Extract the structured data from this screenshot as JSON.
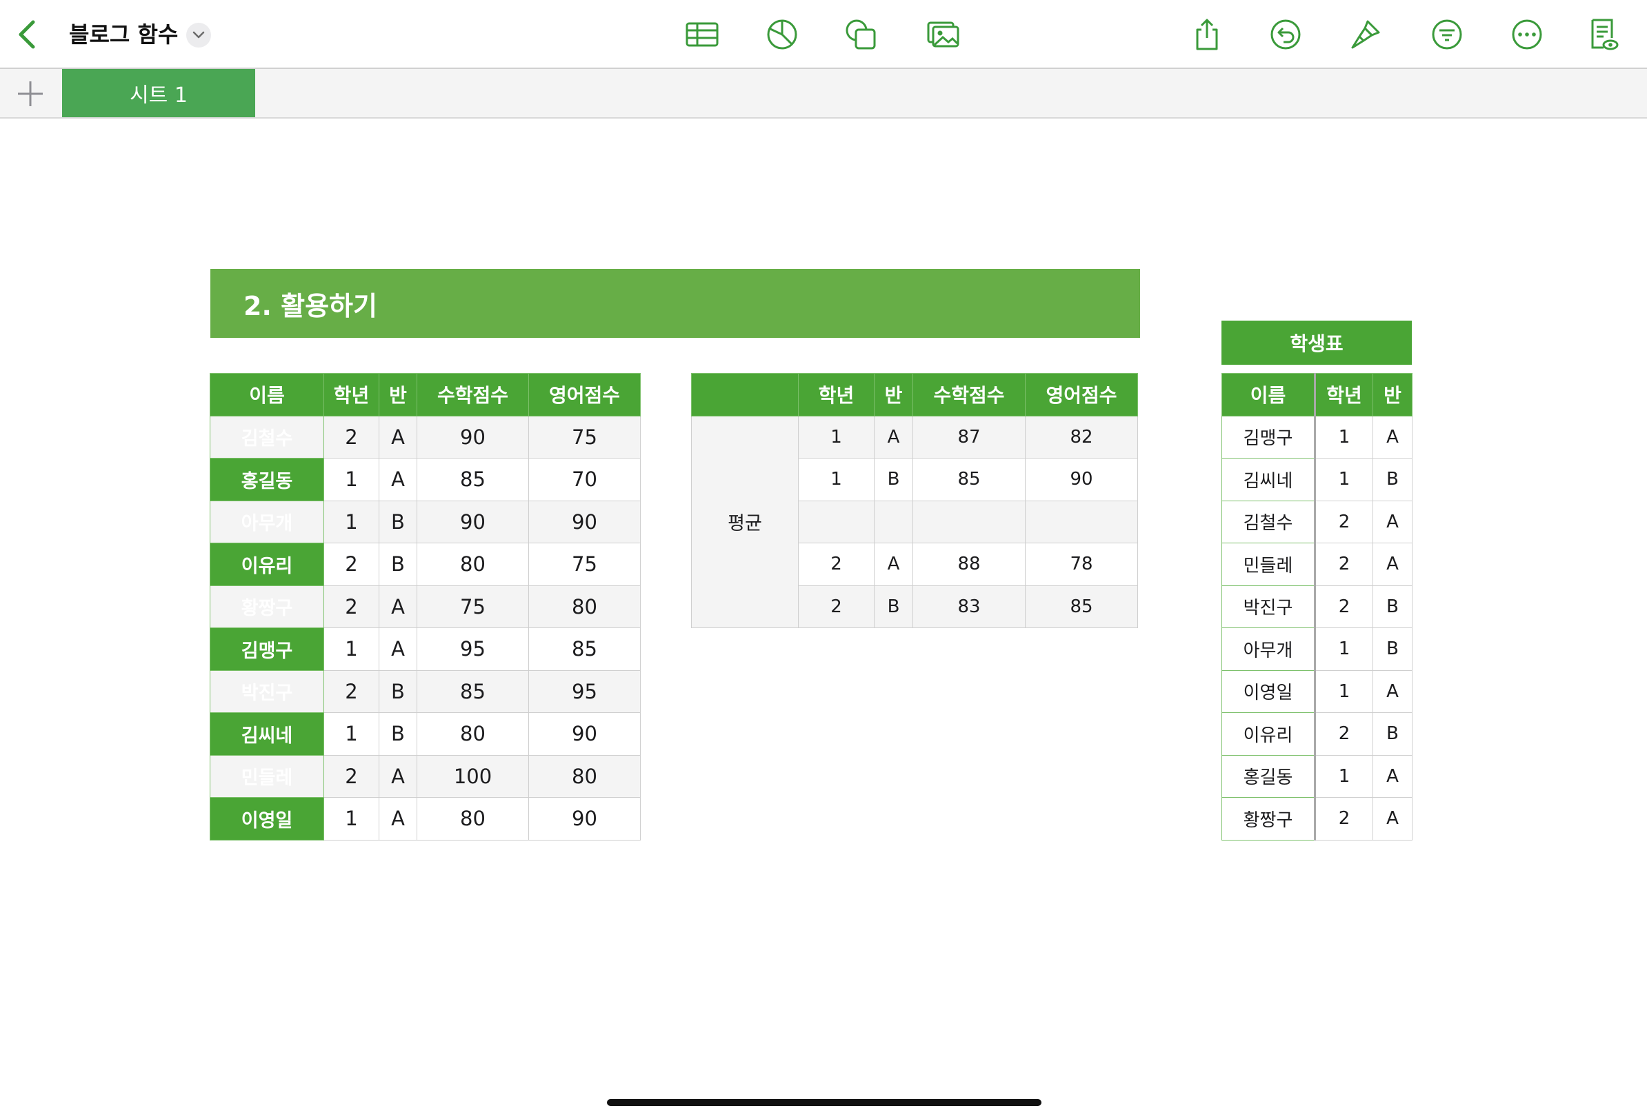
{
  "toolbar": {
    "title": "블로그 함수",
    "accent": "#3a9a3a",
    "icons": [
      "chevron-left-icon",
      "chevron-down-icon",
      "table-icon",
      "chart-icon",
      "shape-icon",
      "media-icon",
      "share-icon",
      "undo-icon",
      "format-brush-icon",
      "filter-icon",
      "more-icon",
      "view-options-icon"
    ]
  },
  "tabs": {
    "sheet_label": "시트 1",
    "active_color": "#4aa654"
  },
  "banner": {
    "title": "2. 활용하기",
    "color": "#67ae47"
  },
  "table1": {
    "headers": [
      "이름",
      "학년",
      "반",
      "수학점수",
      "영어점수"
    ],
    "rows": [
      [
        "김철수",
        "2",
        "A",
        "90",
        "75"
      ],
      [
        "홍길동",
        "1",
        "A",
        "85",
        "70"
      ],
      [
        "아무개",
        "1",
        "B",
        "90",
        "90"
      ],
      [
        "이유리",
        "2",
        "B",
        "80",
        "75"
      ],
      [
        "황짱구",
        "2",
        "A",
        "75",
        "80"
      ],
      [
        "김맹구",
        "1",
        "A",
        "95",
        "85"
      ],
      [
        "박진구",
        "2",
        "B",
        "85",
        "95"
      ],
      [
        "김씨네",
        "1",
        "B",
        "80",
        "90"
      ],
      [
        "민들레",
        "2",
        "A",
        "100",
        "80"
      ],
      [
        "이영일",
        "1",
        "A",
        "80",
        "90"
      ]
    ]
  },
  "table2": {
    "headers": [
      "",
      "학년",
      "반",
      "수학점수",
      "영어점수"
    ],
    "row_label": "평균",
    "rows": [
      [
        "1",
        "A",
        "87",
        "82"
      ],
      [
        "1",
        "B",
        "85",
        "90"
      ],
      [
        "",
        "",
        "",
        ""
      ],
      [
        "2",
        "A",
        "88",
        "78"
      ],
      [
        "2",
        "B",
        "83",
        "85"
      ]
    ]
  },
  "table3": {
    "caption": "학생표",
    "headers": [
      "이름",
      "학년",
      "반"
    ],
    "rows": [
      [
        "김맹구",
        "1",
        "A"
      ],
      [
        "김씨네",
        "1",
        "B"
      ],
      [
        "김철수",
        "2",
        "A"
      ],
      [
        "민들레",
        "2",
        "A"
      ],
      [
        "박진구",
        "2",
        "B"
      ],
      [
        "아무개",
        "1",
        "B"
      ],
      [
        "이영일",
        "1",
        "A"
      ],
      [
        "이유리",
        "2",
        "B"
      ],
      [
        "홍길동",
        "1",
        "A"
      ],
      [
        "황짱구",
        "2",
        "A"
      ]
    ]
  }
}
